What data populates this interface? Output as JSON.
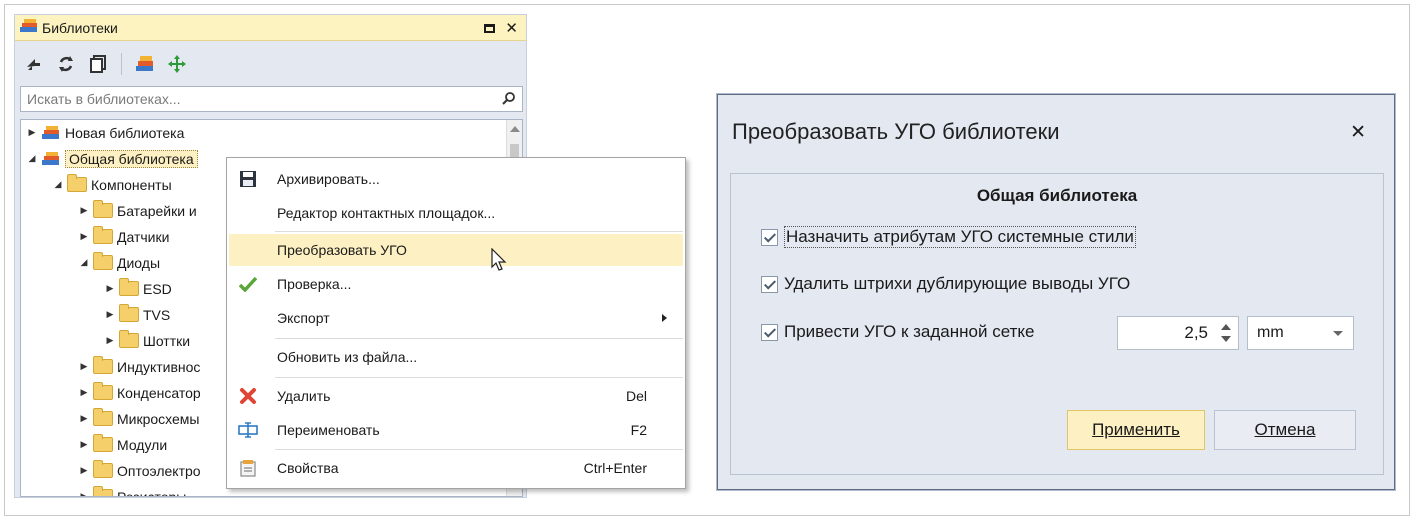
{
  "panel": {
    "title": "Библиотеки",
    "icons": [
      "library-icon",
      "maximize-icon",
      "close-icon"
    ],
    "toolbar": [
      "swap-icon",
      "refresh-icon",
      "copy-icon",
      "library-settings-icon",
      "move-icon"
    ],
    "search": {
      "placeholder": "Искать в библиотеках...",
      "icon": "search-icon"
    }
  },
  "tree": {
    "items": [
      {
        "label": "Новая библиотека",
        "level": 0,
        "expanded": false,
        "icon": "library-icon"
      },
      {
        "label": "Общая библиотека",
        "level": 0,
        "expanded": true,
        "icon": "library-icon",
        "selected": true
      },
      {
        "label": "Компоненты",
        "level": 1,
        "expanded": true,
        "icon": "folder-icon"
      },
      {
        "label": "Батарейки и",
        "level": 2,
        "expanded": false,
        "icon": "folder-icon"
      },
      {
        "label": "Датчики",
        "level": 2,
        "expanded": false,
        "icon": "folder-icon"
      },
      {
        "label": "Диоды",
        "level": 2,
        "expanded": true,
        "icon": "folder-icon"
      },
      {
        "label": "ESD",
        "level": 3,
        "expanded": false,
        "icon": "folder-icon"
      },
      {
        "label": "TVS",
        "level": 3,
        "expanded": false,
        "icon": "folder-icon"
      },
      {
        "label": "Шоттки",
        "level": 3,
        "expanded": false,
        "icon": "folder-icon"
      },
      {
        "label": "Индуктивнос",
        "level": 2,
        "expanded": false,
        "icon": "folder-icon"
      },
      {
        "label": "Конденсатор",
        "level": 2,
        "expanded": false,
        "icon": "folder-icon"
      },
      {
        "label": "Микросхемы",
        "level": 2,
        "expanded": false,
        "icon": "folder-icon"
      },
      {
        "label": "Модули",
        "level": 2,
        "expanded": false,
        "icon": "folder-icon"
      },
      {
        "label": "Оптоэлектро",
        "level": 2,
        "expanded": false,
        "icon": "folder-icon"
      },
      {
        "label": "Резисторы",
        "level": 2,
        "expanded": false,
        "icon": "folder-icon"
      }
    ]
  },
  "context_menu": {
    "items": [
      {
        "label": "Архивировать...",
        "icon": "save-icon",
        "shortcut": ""
      },
      {
        "label": "Редактор контактных площадок...",
        "icon": "",
        "shortcut": ""
      },
      {
        "label": "Преобразовать УГО",
        "icon": "",
        "shortcut": "",
        "highlighted": true
      },
      {
        "label": "Проверка...",
        "icon": "check-icon",
        "shortcut": ""
      },
      {
        "label": "Экспорт",
        "icon": "",
        "shortcut": "",
        "submenu": true
      },
      {
        "label": "Обновить из файла...",
        "icon": "",
        "shortcut": ""
      },
      {
        "label": "Удалить",
        "icon": "delete-icon",
        "shortcut": "Del"
      },
      {
        "label": "Переименовать",
        "icon": "rename-icon",
        "shortcut": "F2"
      },
      {
        "label": "Свойства",
        "icon": "properties-icon",
        "shortcut": "Ctrl+Enter"
      }
    ]
  },
  "dialog": {
    "title": "Преобразовать УГО библиотеки",
    "group_title": "Общая библиотека",
    "options": [
      {
        "label": "Назначить атрибутам УГО системные стили",
        "checked": true
      },
      {
        "label": "Удалить штрихи дублирующие выводы УГО",
        "checked": true
      },
      {
        "label": "Привести УГО к заданной сетке",
        "checked": true
      }
    ],
    "grid_value": "2,5",
    "grid_unit": "mm",
    "apply_label": "Применить",
    "cancel_label": "Отмена"
  },
  "colors": {
    "panel_bg": "#e3e8f1",
    "title_bar": "#fdf3c0",
    "highlight": "#fdf0c2",
    "folder": "#f4cf6a"
  }
}
